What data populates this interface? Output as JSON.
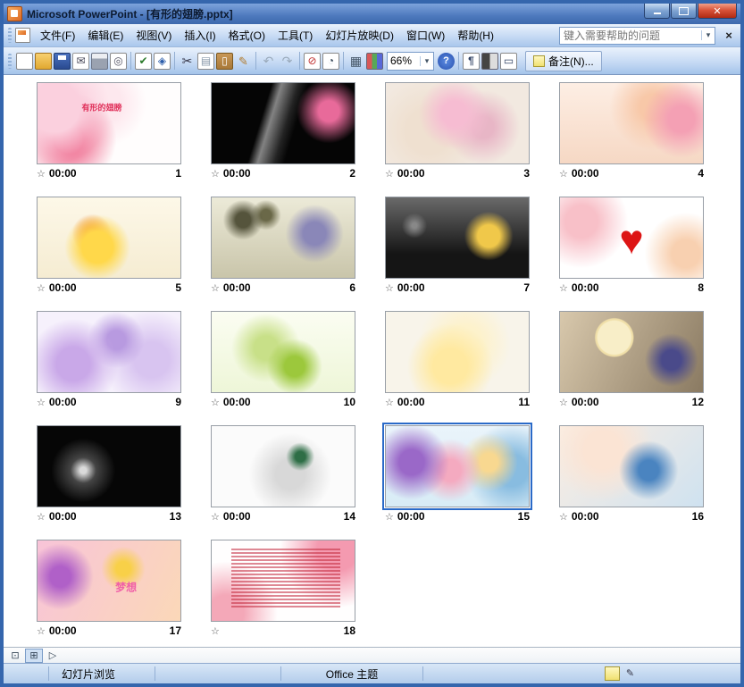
{
  "window": {
    "title": "Microsoft PowerPoint - [有形的翅膀.pptx]"
  },
  "menu": {
    "items": [
      {
        "id": "file",
        "label": "文件(F)"
      },
      {
        "id": "edit",
        "label": "编辑(E)"
      },
      {
        "id": "view",
        "label": "视图(V)"
      },
      {
        "id": "insert",
        "label": "插入(I)"
      },
      {
        "id": "format",
        "label": "格式(O)"
      },
      {
        "id": "tools",
        "label": "工具(T)"
      },
      {
        "id": "slideshow",
        "label": "幻灯片放映(D)"
      },
      {
        "id": "window",
        "label": "窗口(W)"
      },
      {
        "id": "help",
        "label": "帮助(H)"
      }
    ]
  },
  "help": {
    "placeholder": "键入需要帮助的问题"
  },
  "toolbar": {
    "zoom": "66%",
    "notes_label": "备注(N)...",
    "icons": [
      "new",
      "open",
      "save",
      "email",
      "print",
      "print-preview",
      "spelling",
      "research",
      "cut",
      "copy",
      "paste",
      "format-painter",
      "undo",
      "redo",
      "hide-slide",
      "rehearse-timings",
      "grid",
      "color-schemes",
      "zoom",
      "help",
      "show-formatting",
      "grayscale",
      "fit-window",
      "notes"
    ]
  },
  "statusbar": {
    "view_name": "幻灯片浏览",
    "theme": "Office 主题"
  },
  "accent_colors": {
    "selection_border": "#2a6ac8",
    "titlebar": "#4d79bd",
    "toolbar": "#c6daf4"
  },
  "slides": [
    {
      "num": 1,
      "time": "00:00",
      "selected": false,
      "bg": "radial-gradient(circle at 12% 30%, #fbd0de 0 18%, transparent 40%), radial-gradient(circle at 22% 70%, #f07898 0 12%, transparent 38%), radial-gradient(circle at 45% 25%, #fde8ee 0 20%, transparent 45%), #fffdfd",
      "overlay": "有形的翅膀",
      "oc": "#e0305a",
      "os": 9,
      "ox": 45,
      "oy": 30
    },
    {
      "num": 2,
      "time": "00:00",
      "selected": false,
      "bg": "radial-gradient(circle at 82% 35%, #e86a9a 0 8%, transparent 25%), linear-gradient(107deg, rgba(0,0,0,0) 36%, rgba(255,255,255,.5) 42%, rgba(255,255,255,.12) 52%, rgba(0,0,0,0) 58%), #050505"
    },
    {
      "num": 3,
      "time": "00:00",
      "selected": false,
      "bg": "radial-gradient(circle at 48% 38%, #f6bcd2 0 14%, transparent 40%), radial-gradient(circle at 68% 55%, #e8b6c6 0 10%, transparent 35%), radial-gradient(circle at 30% 60%, #efe0d0 0 20%, transparent 50%), #f2e9e0"
    },
    {
      "num": 4,
      "time": "00:00",
      "selected": false,
      "bg": "radial-gradient(circle at 85% 45%, #f4a0b4 0 10%, transparent 30%), radial-gradient(circle at 65% 30%, #f8c8a8 0 12%, transparent 40%), linear-gradient(#fdeee4, #f6d8c4)"
    },
    {
      "num": 5,
      "time": "00:00",
      "selected": false,
      "bg": "radial-gradient(circle at 42% 62%, #ffd84a 0 16%, transparent 34%), radial-gradient(circle at 38% 45%, #f09048 0 6%, transparent 20%), linear-gradient(#fdf8e8, #f5ecd2)"
    },
    {
      "num": 6,
      "time": "00:00",
      "selected": false,
      "bg": "radial-gradient(circle at 22% 28%, #55543c 0 6%, transparent 16%), radial-gradient(circle at 38% 22%, #6a6848 0 5%, transparent 14%), radial-gradient(circle at 72% 45%, #8a87b8 0 10%, transparent 26%), linear-gradient(#ecead8, #c9c5aa)"
    },
    {
      "num": 7,
      "time": "00:00",
      "selected": false,
      "bg": "radial-gradient(circle at 72% 48%, #f0c84a 0 10%, transparent 22%), radial-gradient(circle at 20% 35%, #888888 0 2%, transparent 10%), linear-gradient(#6a6a6a, #151515 70%)"
    },
    {
      "num": 8,
      "time": "00:00",
      "selected": false,
      "bg": "radial-gradient(circle at 15% 30%, #f8c0c8 0 12%, transparent 35%), radial-gradient(circle at 88% 70%, #f8d0b0 0 10%, transparent 30%), #ffffff",
      "overlay": "♥",
      "oc": "#dd1515",
      "os": 46,
      "ox": 50,
      "oy": 52
    },
    {
      "num": 9,
      "time": "00:00",
      "selected": false,
      "bg": "radial-gradient(circle at 25% 65%, #c9a8e8 0 14%, transparent 38%), radial-gradient(circle at 55% 35%, #b89ae0 0 10%, transparent 30%), radial-gradient(circle at 80% 60%, #d8c4f0 0 14%, transparent 40%), #f6f1fc"
    },
    {
      "num": 10,
      "time": "00:00",
      "selected": false,
      "bg": "radial-gradient(circle at 58% 68%, #9cc83c 0 10%, transparent 28%), radial-gradient(circle at 38% 45%, #c8e088 0 12%, transparent 35%), linear-gradient(#fbfdf2, #eef6d8)"
    },
    {
      "num": 11,
      "time": "00:00",
      "selected": false,
      "bg": "radial-gradient(circle at 45% 68%, #ffe9a0 0 18%, transparent 45%), radial-gradient(circle at 55% 40%, #fdf2cc 0 20%, transparent 50%), #f8f4ea"
    },
    {
      "num": 12,
      "time": "00:00",
      "selected": false,
      "bg": "radial-gradient(circle at 38% 32%, #f8eec8 0 16%, #f0dfa8 17% 18%, transparent 19%), radial-gradient(circle at 78% 60%, #4a4a8a 0 8%, transparent 22%), linear-gradient(115deg, #d8c8ac, #8a7a62)"
    },
    {
      "num": 13,
      "time": "00:00",
      "selected": false,
      "bg": "radial-gradient(circle at 32% 55%, rgba(255,255,255,.85) 0 3%, rgba(255,255,255,.25) 12%, transparent 30%), #060606"
    },
    {
      "num": 14,
      "time": "00:00",
      "selected": false,
      "bg": "radial-gradient(circle at 62% 38%, #2e6e46 0 5%, transparent 14%), radial-gradient(circle at 55% 60%, #d8d8d8 0 16%, transparent 45%), #fbfbfb"
    },
    {
      "num": 15,
      "time": "00:00",
      "selected": true,
      "bg": "radial-gradient(circle at 18% 45%, #9a68c8 0 10%, transparent 30%), radial-gradient(circle at 45% 55%, #f4aac0 0 12%, transparent 35%), radial-gradient(circle at 72% 45%, #f8d890 0 8%, transparent 26%), radial-gradient(circle at 88% 55%, #88bce0 0 12%, transparent 35%), linear-gradient(#eaf4fb, #d8ecf6)"
    },
    {
      "num": 16,
      "time": "00:00",
      "selected": false,
      "bg": "radial-gradient(circle at 62% 55%, #4a84c0 0 10%, transparent 30%), radial-gradient(circle at 30% 30%, #fbe4d4 0 16%, transparent 45%), linear-gradient(135deg, #fceee2, #cfe2f0)"
    },
    {
      "num": 17,
      "time": "00:00",
      "selected": false,
      "bg": "radial-gradient(circle at 16% 45%, #b060c8 0 8%, transparent 26%), radial-gradient(circle at 60% 35%, #f8d048 0 7%, transparent 22%), linear-gradient(115deg, #f8c4d8, #fbd8b8)",
      "overlay": "梦想",
      "oc": "#f060a8",
      "os": 12,
      "ox": 62,
      "oy": 58
    },
    {
      "num": 18,
      "time": "",
      "selected": false,
      "bg": "radial-gradient(circle at 88% 12%, #f49ab0 0 14%, transparent 40%), radial-gradient(circle at 10% 90%, #f4a8b8 0 12%, transparent 35%), #fffefe",
      "text_block": true
    }
  ]
}
